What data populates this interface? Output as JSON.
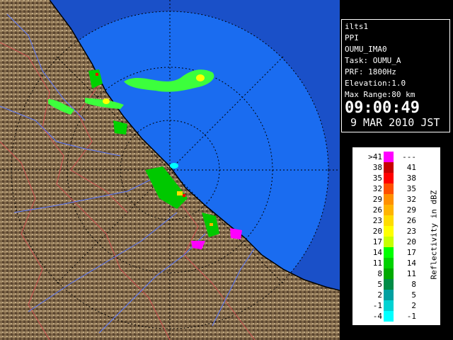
{
  "info": {
    "site": "ilts1",
    "product": "PPI",
    "station": "OUMU_IMA0",
    "task": "Task: OUMU_A",
    "prf": "PRF: 1800Hz",
    "elevation": "Elevation:1.0",
    "max_range": "Max Range:80 km",
    "time": "09:00:49",
    "date": "9 MAR 2010 JST"
  },
  "legend": {
    "title": "Reflectivity in dBZ",
    "rows": [
      {
        "lo": ">41",
        "hi": "---",
        "color": "#ff00ff"
      },
      {
        "lo": "38",
        "hi": "41",
        "color": "#c80000"
      },
      {
        "lo": "35",
        "hi": "38",
        "color": "#ff0000"
      },
      {
        "lo": "32",
        "hi": "35",
        "color": "#ff5000"
      },
      {
        "lo": "29",
        "hi": "32",
        "color": "#ff9000"
      },
      {
        "lo": "26",
        "hi": "29",
        "color": "#ffb400"
      },
      {
        "lo": "23",
        "hi": "26",
        "color": "#ffdc00"
      },
      {
        "lo": "20",
        "hi": "23",
        "color": "#ffff00"
      },
      {
        "lo": "17",
        "hi": "20",
        "color": "#c8ff00"
      },
      {
        "lo": "14",
        "hi": "17",
        "color": "#00ff00"
      },
      {
        "lo": "11",
        "hi": "14",
        "color": "#00d200"
      },
      {
        "lo": "8",
        "hi": "11",
        "color": "#00aa00"
      },
      {
        "lo": "5",
        "hi": "8",
        "color": "#008c46"
      },
      {
        "lo": "2",
        "hi": "5",
        "color": "#00a0a0"
      },
      {
        "lo": "-1",
        "hi": "2",
        "color": "#00d2d2"
      },
      {
        "lo": "-4",
        "hi": "-1",
        "color": "#00ffff"
      }
    ]
  },
  "colors": {
    "sea": "#1a6cf0",
    "outer": "#1a50c8",
    "land": "#7a6448",
    "boundary": "#d05050",
    "river": "#5a78ff"
  }
}
